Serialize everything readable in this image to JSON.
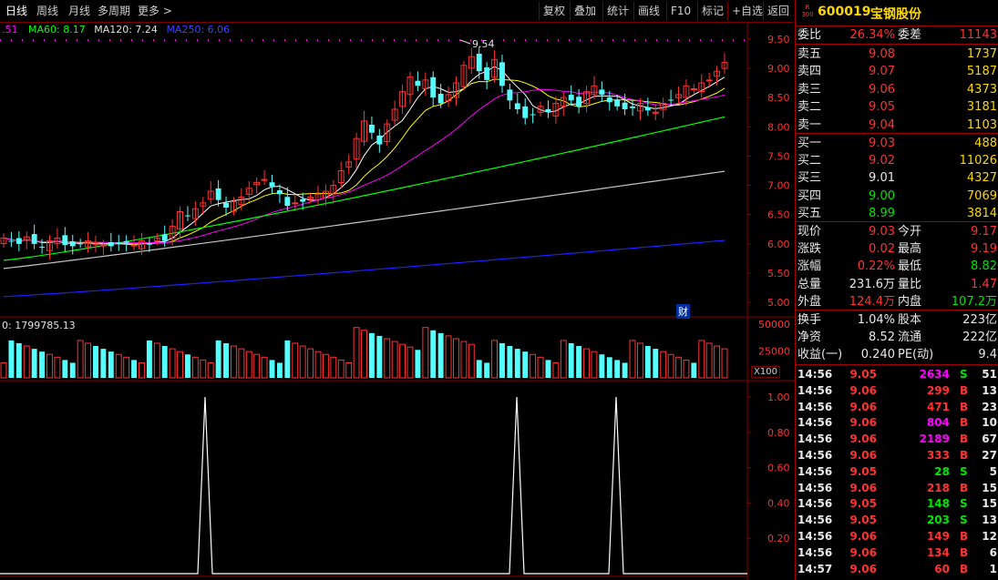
{
  "toolbar": {
    "left": [
      "日线",
      "周线",
      "月线",
      "多周期",
      "更多 >"
    ],
    "right": [
      "复权",
      "叠加",
      "统计",
      "画线",
      "F10",
      "标记",
      "+自选",
      "返回"
    ]
  },
  "ma_legend": {
    "ma30": ".51",
    "ma60": "MA60: 8.17",
    "ma120": "MA120: 7.24",
    "ma250": "MA250: 6.06"
  },
  "price_axis": [
    "9.50",
    "9.00",
    "8.50",
    "8.00",
    "7.50",
    "7.00",
    "6.50",
    "6.00",
    "5.50",
    "5.00"
  ],
  "high_label": "9.54",
  "cai_badge": "财",
  "volume": {
    "readout": "0: 1799785.13",
    "axis": [
      "50000",
      "25000"
    ],
    "unit": "X100"
  },
  "indicator_axis": [
    "1.00",
    "0.80",
    "0.60",
    "0.40",
    "0.20"
  ],
  "colors": {
    "up": "#ff3232",
    "down": "#54ffff",
    "ma5": "#ffffff",
    "ma10": "#ffff00",
    "ma20": "#ff00ff",
    "ma60": "#00ff00",
    "ma120": "#c8c8c8",
    "ma250": "#2020ff",
    "grid": "#8b0000"
  },
  "chart_data": {
    "type": "candlestick",
    "title": "600019 宝钢股份 日线",
    "ylim": [
      4.8,
      9.7
    ],
    "ohlc_close": [
      6.1,
      6.05,
      6.0,
      6.12,
      6.0,
      5.95,
      6.05,
      6.1,
      5.98,
      5.96,
      6.0,
      6.05,
      6.02,
      5.98,
      5.96,
      6.0,
      6.02,
      5.98,
      6.05,
      6.0,
      6.1,
      6.05,
      6.3,
      6.55,
      6.48,
      6.6,
      6.7,
      6.9,
      6.75,
      6.62,
      6.72,
      6.8,
      6.95,
      7.05,
      7.1,
      6.98,
      6.85,
      6.65,
      6.7,
      6.72,
      6.8,
      6.85,
      6.9,
      7.0,
      7.25,
      7.4,
      7.8,
      8.1,
      7.9,
      7.7,
      8.05,
      8.3,
      8.6,
      8.85,
      8.7,
      8.8,
      8.5,
      8.4,
      8.55,
      8.75,
      9.05,
      9.2,
      8.95,
      8.8,
      9.15,
      8.7,
      8.45,
      8.3,
      8.15,
      8.2,
      8.35,
      8.25,
      8.4,
      8.5,
      8.45,
      8.35,
      8.6,
      8.7,
      8.55,
      8.42,
      8.35,
      8.3,
      8.32,
      8.4,
      8.28,
      8.25,
      8.4,
      8.45,
      8.55,
      8.7,
      8.65,
      8.75,
      8.8,
      8.95,
      9.1
    ],
    "volume_axis_max": 50000,
    "indicator_peaks": [
      {
        "index": 32,
        "value": 1.0
      },
      {
        "index": 82,
        "value": 1.0
      },
      {
        "index": 98,
        "value": 1.0
      }
    ]
  },
  "quote": {
    "code": "600019",
    "name": "宝钢股份",
    "badge": "R\n300",
    "weibi_label": "委比",
    "weibi": "26.34%",
    "weicha_label": "委差",
    "weicha": "11143",
    "asks": [
      {
        "label": "卖五",
        "price": "9.08",
        "vol": "1737"
      },
      {
        "label": "卖四",
        "price": "9.07",
        "vol": "5187"
      },
      {
        "label": "卖三",
        "price": "9.06",
        "vol": "4373"
      },
      {
        "label": "卖二",
        "price": "9.05",
        "vol": "3181"
      },
      {
        "label": "卖一",
        "price": "9.04",
        "vol": "1103"
      }
    ],
    "bids": [
      {
        "label": "买一",
        "price": "9.03",
        "vol": "488"
      },
      {
        "label": "买二",
        "price": "9.02",
        "vol": "11026"
      },
      {
        "label": "买三",
        "price": "9.01",
        "vol": "4327"
      },
      {
        "label": "买四",
        "price": "9.00",
        "vol": "7069"
      },
      {
        "label": "买五",
        "price": "8.99",
        "vol": "3814"
      }
    ],
    "stats": [
      {
        "l1": "现价",
        "v1": "9.03",
        "l2": "今开",
        "v2": "9.17",
        "c1": "red",
        "c2": "red"
      },
      {
        "l1": "涨跌",
        "v1": "0.02",
        "l2": "最高",
        "v2": "9.19",
        "c1": "red",
        "c2": "red"
      },
      {
        "l1": "涨幅",
        "v1": "0.22%",
        "l2": "最低",
        "v2": "8.82",
        "c1": "red",
        "c2": "grn"
      },
      {
        "l1": "总量",
        "v1": "231.6万",
        "l2": "量比",
        "v2": "1.47",
        "c1": "wht",
        "c2": "red"
      },
      {
        "l1": "外盘",
        "v1": "124.4万",
        "l2": "内盘",
        "v2": "107.2万",
        "c1": "red",
        "c2": "grn"
      }
    ],
    "fin": [
      {
        "l1": "换手",
        "v1": "1.04%",
        "l2": "股本",
        "v2": "223亿"
      },
      {
        "l1": "净资",
        "v1": "8.52",
        "l2": "流通",
        "v2": "222亿"
      },
      {
        "l1": "收益(一)",
        "v1": "0.240",
        "l2": "PE(动)",
        "v2": "9.4"
      }
    ]
  },
  "ticks": [
    {
      "t": "14:56",
      "p": "9.05",
      "v": "2634",
      "s": "S",
      "n": "51"
    },
    {
      "t": "14:56",
      "p": "9.06",
      "v": "299",
      "s": "B",
      "n": "13"
    },
    {
      "t": "14:56",
      "p": "9.06",
      "v": "471",
      "s": "B",
      "n": "23"
    },
    {
      "t": "14:56",
      "p": "9.06",
      "v": "804",
      "s": "B",
      "n": "10"
    },
    {
      "t": "14:56",
      "p": "9.06",
      "v": "2189",
      "s": "B",
      "n": "67"
    },
    {
      "t": "14:56",
      "p": "9.06",
      "v": "333",
      "s": "B",
      "n": "27"
    },
    {
      "t": "14:56",
      "p": "9.05",
      "v": "28",
      "s": "S",
      "n": "5"
    },
    {
      "t": "14:56",
      "p": "9.06",
      "v": "218",
      "s": "B",
      "n": "15"
    },
    {
      "t": "14:56",
      "p": "9.05",
      "v": "148",
      "s": "S",
      "n": "15"
    },
    {
      "t": "14:56",
      "p": "9.05",
      "v": "203",
      "s": "S",
      "n": "13"
    },
    {
      "t": "14:56",
      "p": "9.06",
      "v": "149",
      "s": "B",
      "n": "12"
    },
    {
      "t": "14:56",
      "p": "9.06",
      "v": "134",
      "s": "B",
      "n": "6"
    },
    {
      "t": "14:57",
      "p": "9.06",
      "v": "60",
      "s": "B",
      "n": "1"
    }
  ]
}
